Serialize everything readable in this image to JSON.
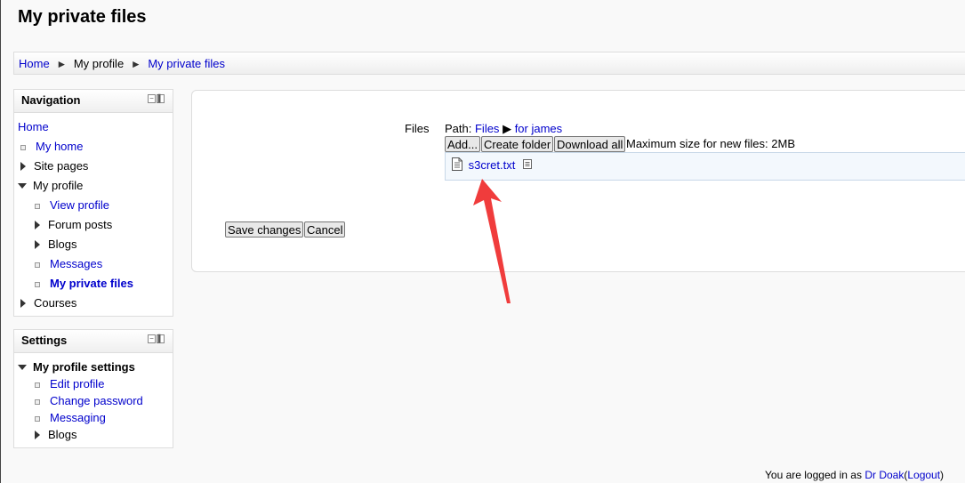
{
  "page_title": "My private files",
  "breadcrumb": {
    "items": [
      {
        "label": "Home",
        "link": true
      },
      {
        "label": "My profile",
        "link": false
      },
      {
        "label": "My private files",
        "link": true
      }
    ],
    "separator": "►"
  },
  "navigation": {
    "title": "Navigation",
    "items": [
      {
        "label": "Home"
      },
      {
        "label": "My home"
      },
      {
        "label": "Site pages"
      },
      {
        "label": "My profile"
      },
      {
        "label": "View profile"
      },
      {
        "label": "Forum posts"
      },
      {
        "label": "Blogs"
      },
      {
        "label": "Messages"
      },
      {
        "label": "My private files"
      },
      {
        "label": "Courses"
      }
    ]
  },
  "settings": {
    "title": "Settings",
    "items": [
      {
        "label": "My profile settings"
      },
      {
        "label": "Edit profile"
      },
      {
        "label": "Change password"
      },
      {
        "label": "Messaging"
      },
      {
        "label": "Blogs"
      }
    ]
  },
  "files": {
    "label": "Files",
    "path_label": "Path:",
    "path": [
      {
        "label": "Files"
      },
      {
        "label": "for james"
      }
    ],
    "path_separator": "▶",
    "buttons": {
      "add": "Add...",
      "create_folder": "Create folder",
      "download_all": "Download all"
    },
    "max_size": "Maximum size for new files: 2MB",
    "file_list": [
      {
        "name": "s3cret.txt",
        "icon": "text-file-icon"
      }
    ]
  },
  "form": {
    "save": "Save changes",
    "cancel": "Cancel"
  },
  "footer": {
    "prefix": "You are logged in as",
    "user": "Dr Doak",
    "logout": "Logout",
    "open_paren": "(",
    "close_paren": ")"
  },
  "colors": {
    "link": "#0000cc",
    "annotation_arrow": "#f03c3c",
    "file_area_bg": "#f3f8fd"
  }
}
